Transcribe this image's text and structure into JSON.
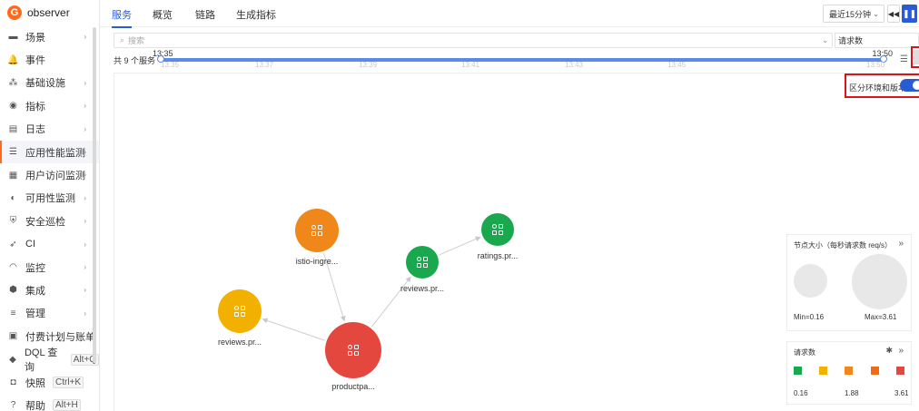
{
  "brand": {
    "name": "observer"
  },
  "sidebar": {
    "items": [
      {
        "label": "场景",
        "icon": "monitor-icon",
        "glyph": "▬",
        "arrow": true
      },
      {
        "label": "事件",
        "icon": "bell-icon",
        "glyph": "🔔",
        "arrow": false
      },
      {
        "label": "基础设施",
        "icon": "cluster-icon",
        "glyph": "⁂",
        "arrow": true
      },
      {
        "label": "指标",
        "icon": "gauge-icon",
        "glyph": "◉",
        "arrow": true
      },
      {
        "label": "日志",
        "icon": "log-icon",
        "glyph": "▤",
        "arrow": true
      },
      {
        "label": "应用性能监测",
        "icon": "apm-icon",
        "glyph": "☰",
        "arrow": true,
        "active": true
      },
      {
        "label": "用户访问监测",
        "icon": "rum-icon",
        "glyph": "▦",
        "arrow": true
      },
      {
        "label": "可用性监测",
        "icon": "globe-icon",
        "glyph": "◐",
        "arrow": true
      },
      {
        "label": "安全巡检",
        "icon": "shield-icon",
        "glyph": "⛨",
        "arrow": true
      },
      {
        "label": "CI",
        "icon": "rocket-icon",
        "glyph": "➶",
        "arrow": true
      },
      {
        "label": "监控",
        "icon": "radar-icon",
        "glyph": "◠",
        "arrow": true
      },
      {
        "label": "集成",
        "icon": "hexagon-icon",
        "glyph": "⬢",
        "arrow": true
      },
      {
        "label": "管理",
        "icon": "settings-list-icon",
        "glyph": "≡",
        "arrow": true
      },
      {
        "label": "付费计划与账单",
        "icon": "billing-icon",
        "glyph": "▣",
        "arrow": false
      },
      {
        "label": "DQL 查询",
        "icon": "dql-icon",
        "glyph": "◆",
        "arrow": false,
        "shortcut": "Alt+Q"
      },
      {
        "label": "快照",
        "icon": "camera-icon",
        "glyph": "◘",
        "arrow": false,
        "shortcut": "Ctrl+K"
      },
      {
        "label": "帮助",
        "icon": "help-icon",
        "glyph": "?",
        "arrow": false,
        "shortcut": "Alt+H"
      }
    ]
  },
  "tabs": [
    {
      "label": "服务",
      "active": true
    },
    {
      "label": "概览",
      "active": false
    },
    {
      "label": "链路",
      "active": false
    },
    {
      "label": "生成指标",
      "active": false
    }
  ],
  "time": {
    "range_label": "最近15分钟"
  },
  "search": {
    "placeholder": "搜索"
  },
  "metric": {
    "selected": "请求数"
  },
  "service_count": "共 9 个服务",
  "timeline": {
    "start": "13:35",
    "end": "13:50",
    "ticks": [
      "13:35",
      "13:37",
      "13:39",
      "13:41",
      "13:43",
      "13:45",
      "13:50"
    ]
  },
  "toggle": {
    "label": "区分环境和版本",
    "on": true
  },
  "colors": {
    "accent": "#2a5bd7",
    "orange": "#f0871a",
    "green": "#1aa84f",
    "yellow": "#f2b100",
    "red": "#e3473d"
  },
  "nodes": [
    {
      "id": "istio",
      "label": "istio-ingre...",
      "color": "#f0871a"
    },
    {
      "id": "ratings",
      "label": "ratings.pr...",
      "color": "#1aa84f"
    },
    {
      "id": "reviewsA",
      "label": "reviews.pr...",
      "color": "#1aa84f"
    },
    {
      "id": "reviewsB",
      "label": "reviews.pr...",
      "color": "#f2b100"
    },
    {
      "id": "product",
      "label": "productpa...",
      "color": "#e3473d"
    }
  ],
  "edges": [
    [
      "istio",
      "product"
    ],
    [
      "product",
      "reviewsB"
    ],
    [
      "product",
      "reviewsA"
    ],
    [
      "reviewsA",
      "ratings"
    ]
  ],
  "legend_size": {
    "title": "节点大小（每秒请求数 req/s）",
    "min_label": "Min=0.16",
    "max_label": "Max=3.61"
  },
  "legend_color": {
    "title": "请求数",
    "swatches": [
      "#1aa84f",
      "#f2b100",
      "#f0871a",
      "#f06a1a",
      "#e3473d"
    ],
    "values": [
      "0.16",
      "1.88",
      "3.61"
    ]
  }
}
